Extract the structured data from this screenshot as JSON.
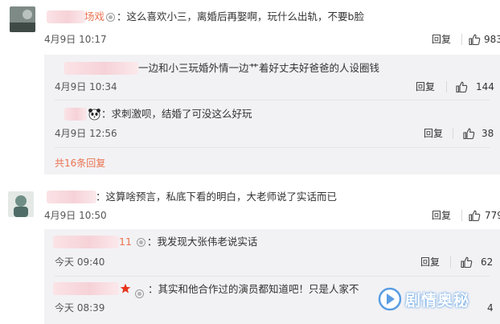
{
  "comments": [
    {
      "username_suffix": "场戏",
      "text": "：这么喜欢小三，离婚后再娶啊，玩什么出轨，不要b脸",
      "time": "4月9日 10:17",
      "reply_label": "回复",
      "likes": "983",
      "replies": [
        {
          "text": "一边和小三玩婚外情一边艹着好丈夫好爸爸的人设圈钱",
          "time": "4月9日 10:34",
          "reply_label": "回复",
          "likes": "144"
        },
        {
          "text": "：求刺激呗，结婚了可没这么好玩",
          "time": "4月9日 12:56",
          "reply_label": "回复",
          "likes": "38"
        }
      ],
      "more_replies": "共16条回复"
    },
    {
      "text": "：这算啥预言，私底下看的明白，大老师说了实话而已",
      "time": "4月9日 10:50",
      "reply_label": "回复",
      "likes": "779",
      "replies": [
        {
          "username_suffix": "11",
          "text": "：我发现大张伟老说实话",
          "time": "今天 09:40",
          "reply_label": "回复",
          "likes": "62"
        },
        {
          "text": "：其实和他合作过的演员都知道吧！只是人家不",
          "time": "今天 08:39",
          "reply_label": "回复",
          "likes": "4"
        }
      ]
    }
  ],
  "watermark": {
    "text": "剧情奥秘",
    "color": "#5b9ee3"
  },
  "colors": {
    "accent": "#eb7350",
    "reply_bg": "#f2f2f5"
  },
  "icons": [
    "thumbs-up-icon",
    "badge-icon",
    "panda-emoji-icon",
    "star-icon"
  ]
}
